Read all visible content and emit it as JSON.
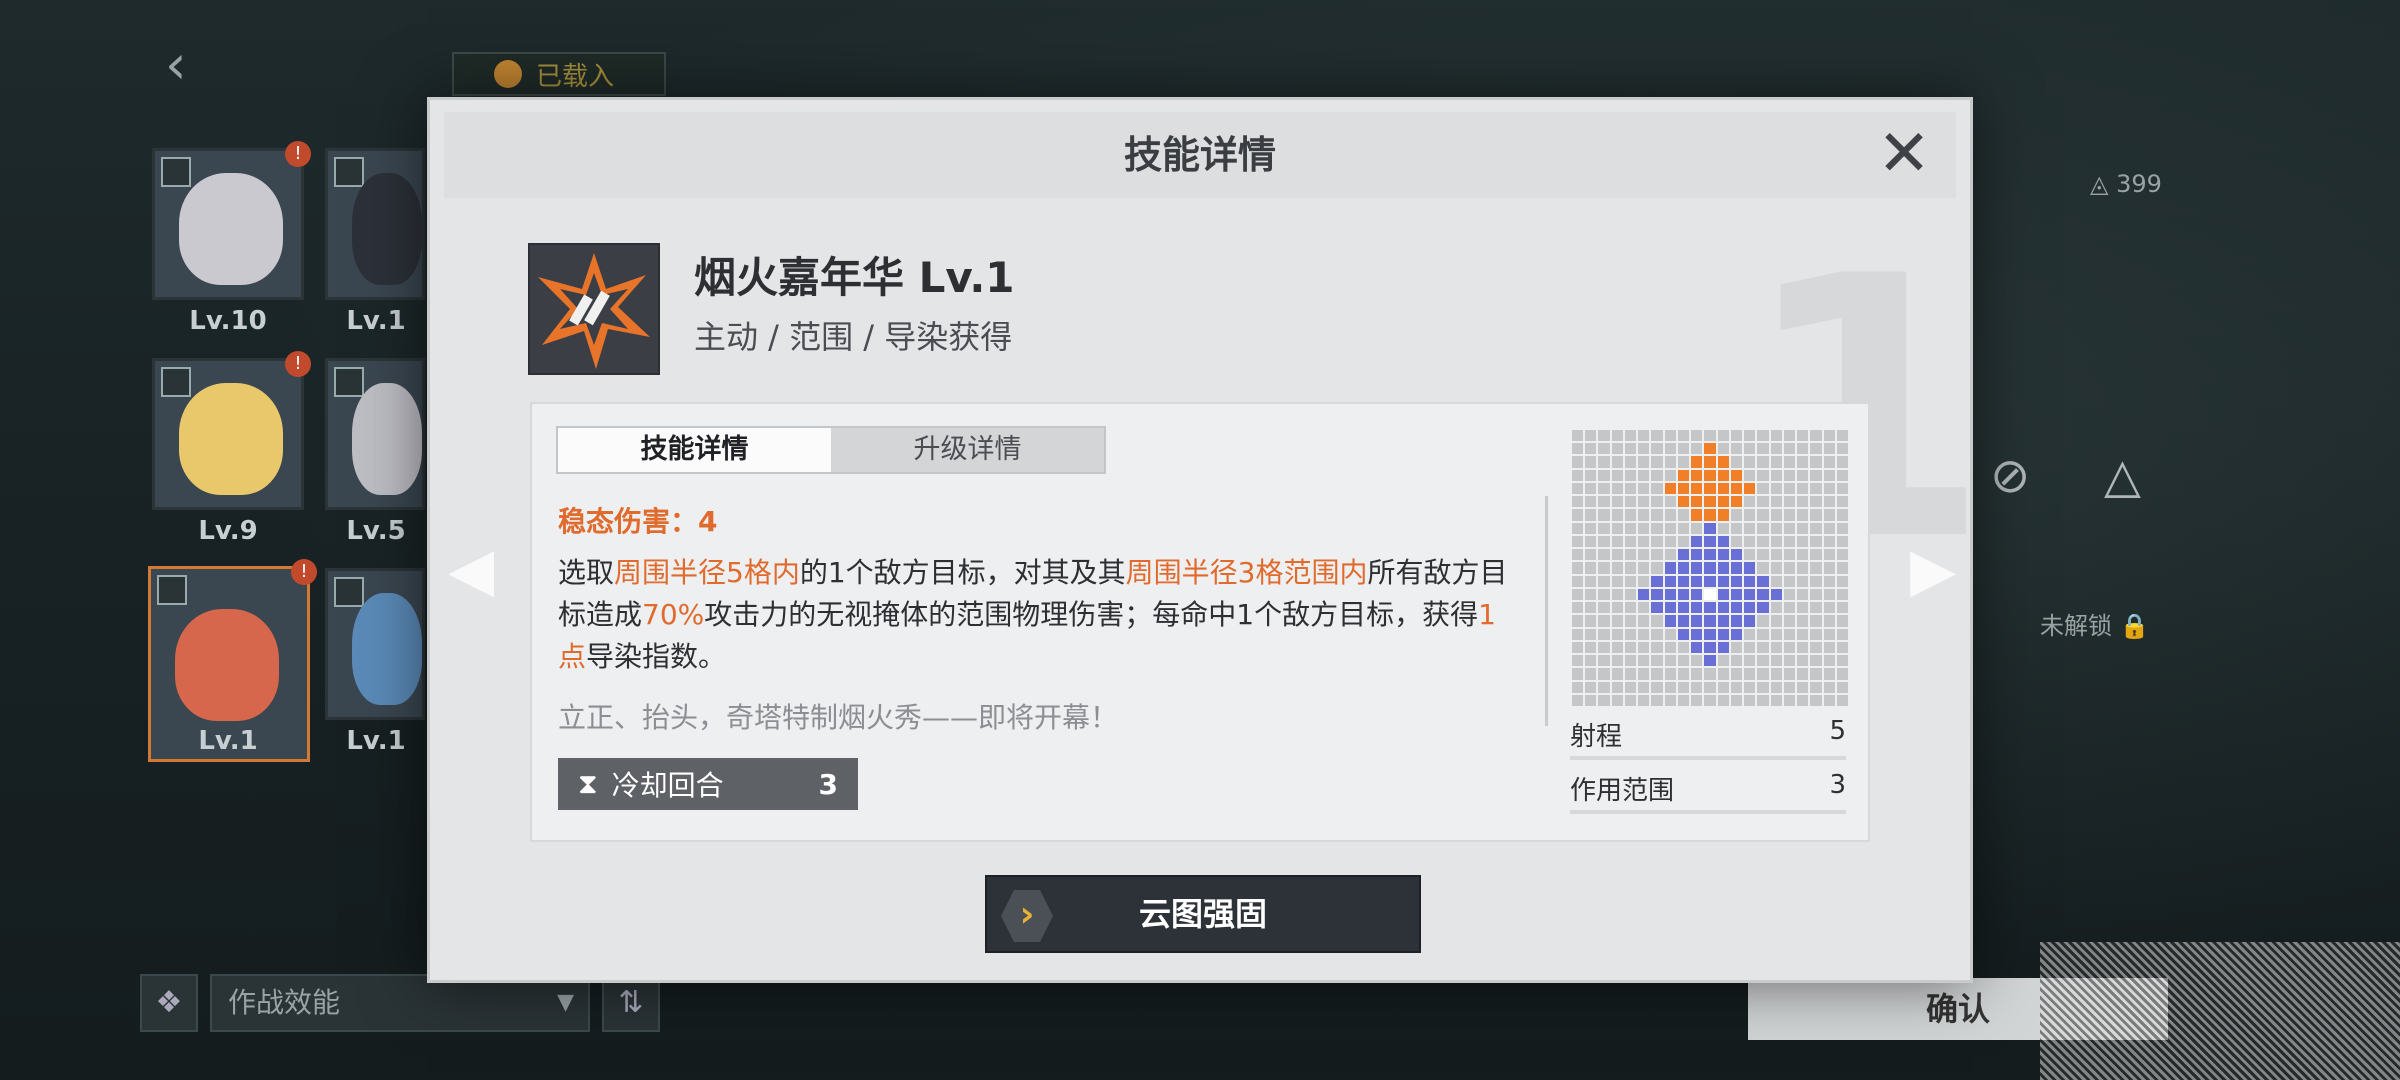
{
  "background": {
    "loaded_tag": "已载入",
    "characters": [
      {
        "level": "Lv.10",
        "selected": false
      },
      {
        "level": "Lv.1",
        "selected": false
      },
      {
        "level": "Lv.9",
        "selected": false
      },
      {
        "level": "Lv.5",
        "selected": false
      },
      {
        "level": "Lv.1",
        "selected": true
      },
      {
        "level": "Lv.1",
        "selected": false
      }
    ],
    "filter_label": "作战效能",
    "currency": "399",
    "unlock_text": "未解锁",
    "confirm_label": "确认"
  },
  "modal": {
    "title": "技能详情",
    "big_number": "1",
    "skill_name": "烟火嘉年华 Lv.1",
    "skill_type": "主动 / 范围 / 导染获得",
    "tabs": [
      "技能详情",
      "升级详情"
    ],
    "active_tab": 0,
    "damage_label": "稳态伤害：4",
    "desc": {
      "p1": "选取",
      "h1": "周围半径5格内",
      "p2": "的1个敌方目标，对其及其",
      "h2": "周围半径3格范围内",
      "p3": "所有敌方目标造成",
      "h3": "70%",
      "p4": "攻击力的无视掩体的范围物理伤害；每命中1个敌方目标，获得",
      "h4": "1点",
      "p5": "导染指数。"
    },
    "flavor": "立正、抬头，奇塔特制烟火秀——即将开幕！",
    "cooldown_label": "冷却回合",
    "cooldown_value": "3",
    "stats": [
      {
        "label": "射程",
        "value": "5"
      },
      {
        "label": "作用范围",
        "value": "3"
      }
    ],
    "strengthen_label": "云图强固",
    "colors": {
      "accent": "#e06b2d",
      "range_orange": "#f07f28",
      "range_blue": "#6a6fd6"
    }
  }
}
